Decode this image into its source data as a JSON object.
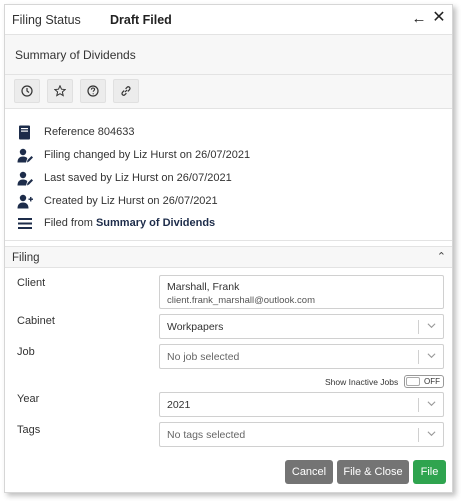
{
  "header": {
    "label": "Filing Status",
    "status": "Draft Filed"
  },
  "summary": {
    "title": "Summary of Dividends"
  },
  "toolbar": {
    "buttons": [
      "clock-icon",
      "star-icon",
      "help-icon",
      "link-icon"
    ]
  },
  "info": {
    "reference": "Reference 804633",
    "filing_changed": "Filing changed by Liz Hurst on 26/07/2021",
    "last_saved": "Last saved by Liz Hurst on 26/07/2021",
    "created": "Created by Liz Hurst on 26/07/2021",
    "filed_from_prefix": "Filed from",
    "filed_from_name": "Summary of Dividends"
  },
  "filing": {
    "section_title": "Filing",
    "client_label": "Client",
    "client_name": "Marshall, Frank",
    "client_email": "client.frank_marshall@outlook.com",
    "cabinet_label": "Cabinet",
    "cabinet_value": "Workpapers",
    "job_label": "Job",
    "job_placeholder": "No job selected",
    "show_inactive_label": "Show Inactive Jobs",
    "show_inactive_state": "OFF",
    "year_label": "Year",
    "year_value": "2021",
    "tags_label": "Tags",
    "tags_placeholder": "No tags selected"
  },
  "actions": {
    "cancel": "Cancel",
    "file_close": "File & Close",
    "file": "File"
  },
  "colors": {
    "file_button": "#2fa44f",
    "secondary_button": "#747474",
    "icon_dark": "#1d2c4a"
  }
}
